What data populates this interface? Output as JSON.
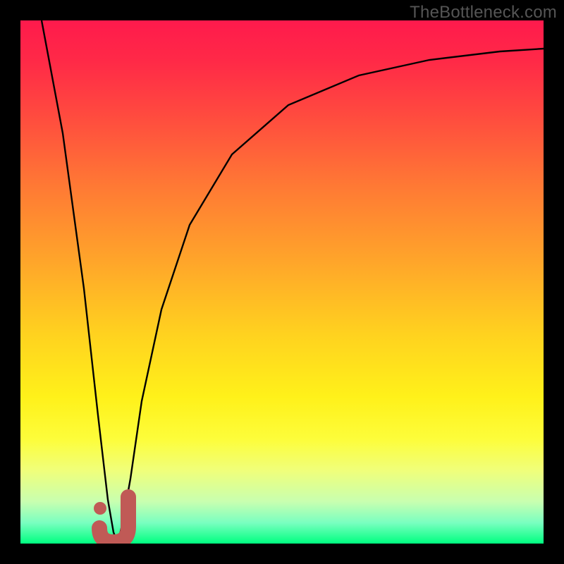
{
  "watermark": "TheBottleneck.com",
  "colors": {
    "background": "#000000",
    "curve_stroke": "#000000",
    "marker_stroke": "#c05a56",
    "marker_fill": "#c05a56",
    "gradient_top": "#ff1a4c",
    "gradient_bottom": "#00ff80"
  },
  "chart_data": {
    "type": "line",
    "title": "",
    "xlabel": "",
    "ylabel": "",
    "xlim": [
      0,
      100
    ],
    "ylim": [
      0,
      100
    ],
    "grid": false,
    "series": [
      {
        "name": "bottleneck-curve",
        "x": [
          0,
          5,
          10,
          14,
          15,
          16,
          18,
          20,
          24,
          30,
          38,
          48,
          60,
          75,
          88,
          100
        ],
        "values": [
          100,
          66,
          33,
          6,
          0,
          4,
          14,
          26,
          44,
          60,
          72,
          81,
          87,
          91,
          93,
          94
        ]
      }
    ],
    "marker": {
      "name": "optimal-point",
      "shape": "J",
      "x_range": [
        14,
        18.5
      ],
      "y_range": [
        0,
        9
      ]
    },
    "legend": null
  }
}
